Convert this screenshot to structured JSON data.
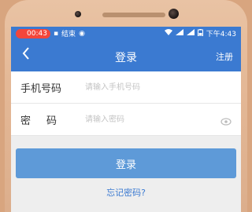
{
  "status_bar": {
    "time_left": "00:43",
    "end_label": "结束",
    "time_right": "下午4:43"
  },
  "app_bar": {
    "back_icon": "‹",
    "title": "登录",
    "register": "注册"
  },
  "form": {
    "phone_label": "手机号码",
    "phone_placeholder": "请输入手机号码",
    "password_label": "密码",
    "password_placeholder": "请输入密码"
  },
  "actions": {
    "login_button": "登录",
    "forgot_link": "忘记密码?"
  },
  "colors": {
    "primary": "#3b7ad1",
    "button": "#5e9ad8"
  }
}
